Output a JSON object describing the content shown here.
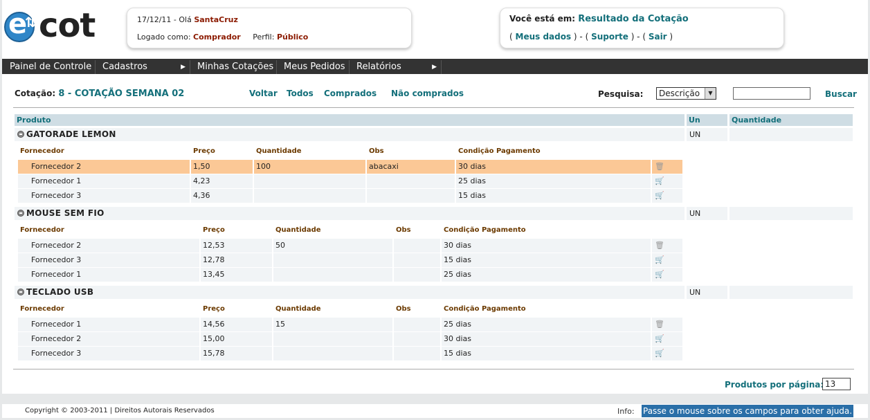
{
  "header": {
    "logo_text": "ecot",
    "date_greeting": "17/12/11 - Olá",
    "user_name": "SantaCruz",
    "logged_as_label": "Logado como:",
    "logged_as_value": "Comprador",
    "profile_label": "Perfil:",
    "profile_value": "Público",
    "location_label": "Você está em:",
    "location_value": "Resultado da Cotação",
    "links": [
      "Meus dados",
      "Suporte",
      "Sair"
    ]
  },
  "menu": [
    "Painel de Controle",
    "Cadastros",
    "Minhas Cotações",
    "Meus Pedidos",
    "Relatórios"
  ],
  "toolbar": {
    "cotacao_label": "Cotação:",
    "cotacao_value": "8 - COTAÇÃO SEMANA 02",
    "links": [
      "Voltar",
      "Todos",
      "Comprados",
      "Não comprados"
    ],
    "search_label": "Pesquisa:",
    "search_select": "Descrição",
    "search_input": "",
    "search_button": "Buscar"
  },
  "table": {
    "headers": [
      "Produto",
      "Un",
      "Quantidade"
    ],
    "sub_headers": [
      "Fornecedor",
      "Preço",
      "Quantidade",
      "Obs",
      "Condição Pagamento"
    ],
    "products": [
      {
        "name": "GATORADE LEMON",
        "unit": "UN",
        "rows": [
          {
            "fornecedor": "Fornecedor 2",
            "preco": "1,50",
            "quantidade": "100",
            "obs": "abacaxi",
            "condicao": "30 dias",
            "action": "trash-icon",
            "selected": true
          },
          {
            "fornecedor": "Fornecedor 1",
            "preco": "4,23",
            "quantidade": "",
            "obs": "",
            "condicao": "25 dias",
            "action": "cart-icon",
            "selected": false
          },
          {
            "fornecedor": "Fornecedor 3",
            "preco": "4,36",
            "quantidade": "",
            "obs": "",
            "condicao": "15 dias",
            "action": "cart-icon",
            "selected": false
          }
        ]
      },
      {
        "name": "MOUSE SEM FIO",
        "unit": "UN",
        "rows": [
          {
            "fornecedor": "Fornecedor 2",
            "preco": "12,53",
            "quantidade": "50",
            "obs": "",
            "condicao": "30 dias",
            "action": "trash-icon",
            "selected": false
          },
          {
            "fornecedor": "Fornecedor 3",
            "preco": "12,78",
            "quantidade": "",
            "obs": "",
            "condicao": "15 dias",
            "action": "cart-icon",
            "selected": false
          },
          {
            "fornecedor": "Fornecedor 1",
            "preco": "13,45",
            "quantidade": "",
            "obs": "",
            "condicao": "25 dias",
            "action": "cart-icon",
            "selected": false
          }
        ]
      },
      {
        "name": "TECLADO USB",
        "unit": "UN",
        "rows": [
          {
            "fornecedor": "Fornecedor 1",
            "preco": "14,56",
            "quantidade": "15",
            "obs": "",
            "condicao": "25 dias",
            "action": "trash-icon",
            "selected": false
          },
          {
            "fornecedor": "Fornecedor 2",
            "preco": "15,00",
            "quantidade": "",
            "obs": "",
            "condicao": "30 dias",
            "action": "cart-icon",
            "selected": false
          },
          {
            "fornecedor": "Fornecedor 3",
            "preco": "15,78",
            "quantidade": "",
            "obs": "",
            "condicao": "15 dias",
            "action": "cart-icon",
            "selected": false
          }
        ]
      }
    ]
  },
  "pagination": {
    "label": "Produtos por página:",
    "value": "13"
  },
  "footer": {
    "copyright": "Copyright © 2003-2011 | Direitos Autorais Reservados",
    "info_label": "Info:",
    "info_text": "Passe o mouse sobre os campos para obter ajuda."
  },
  "colors": {
    "accent": "#136f7a",
    "menu_bg": "#333333",
    "selected_row": "#fbc896",
    "label_brown": "#8b1a00"
  }
}
